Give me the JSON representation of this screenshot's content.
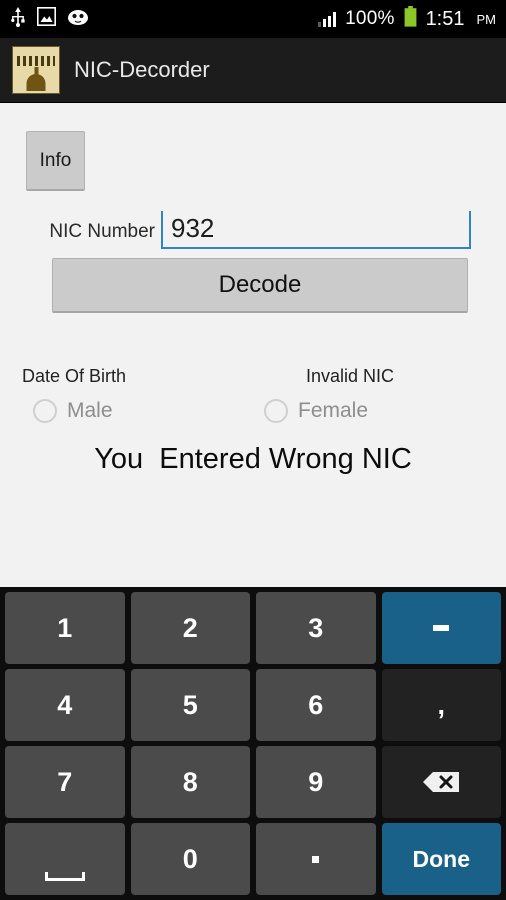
{
  "statusbar": {
    "icons_left": [
      "usb-icon",
      "image-icon",
      "android-head-icon"
    ],
    "battery_percent": "100%",
    "time": "1:51",
    "ampm": "PM",
    "signal_bars_filled": 3
  },
  "actionbar": {
    "app_icon": "app-logo-icon",
    "title": "NIC-Decorder"
  },
  "content": {
    "info_button": "Info",
    "nic_label": "NIC Number",
    "nic_value": "932",
    "nic_placeholder": "",
    "decode_button": "Decode",
    "dob_label": "Date Of Birth",
    "status_label": "Invalid NIC",
    "radio_male": "Male",
    "radio_female": "Female",
    "result_message": "You  Entered Wrong NIC"
  },
  "keyboard": {
    "rows": [
      [
        {
          "label": "1",
          "name": "key-1",
          "style": "num"
        },
        {
          "label": "2",
          "name": "key-2",
          "style": "num"
        },
        {
          "label": "3",
          "name": "key-3",
          "style": "num"
        },
        {
          "label": "-",
          "name": "key-minus",
          "style": "blue"
        }
      ],
      [
        {
          "label": "4",
          "name": "key-4",
          "style": "num"
        },
        {
          "label": "5",
          "name": "key-5",
          "style": "num"
        },
        {
          "label": "6",
          "name": "key-6",
          "style": "num"
        },
        {
          "label": ",",
          "name": "key-comma",
          "style": "dark"
        }
      ],
      [
        {
          "label": "7",
          "name": "key-7",
          "style": "num"
        },
        {
          "label": "8",
          "name": "key-8",
          "style": "num"
        },
        {
          "label": "9",
          "name": "key-9",
          "style": "num"
        },
        {
          "label": "",
          "name": "key-backspace",
          "style": "dark"
        }
      ],
      [
        {
          "label": "",
          "name": "key-space",
          "style": "num"
        },
        {
          "label": "0",
          "name": "key-0",
          "style": "num"
        },
        {
          "label": ".",
          "name": "key-period",
          "style": "num"
        },
        {
          "label": "Done",
          "name": "key-done",
          "style": "blue"
        }
      ]
    ],
    "done_label": "Done"
  },
  "colors": {
    "accent_blue": "#2e86c4",
    "key_blue": "#1a6189",
    "key_grey": "#4b4b4b",
    "key_dark": "#222222",
    "battery_green": "#8bc727",
    "page_bg": "#f2f2f2",
    "actionbar_bg": "#1c1c1c"
  }
}
